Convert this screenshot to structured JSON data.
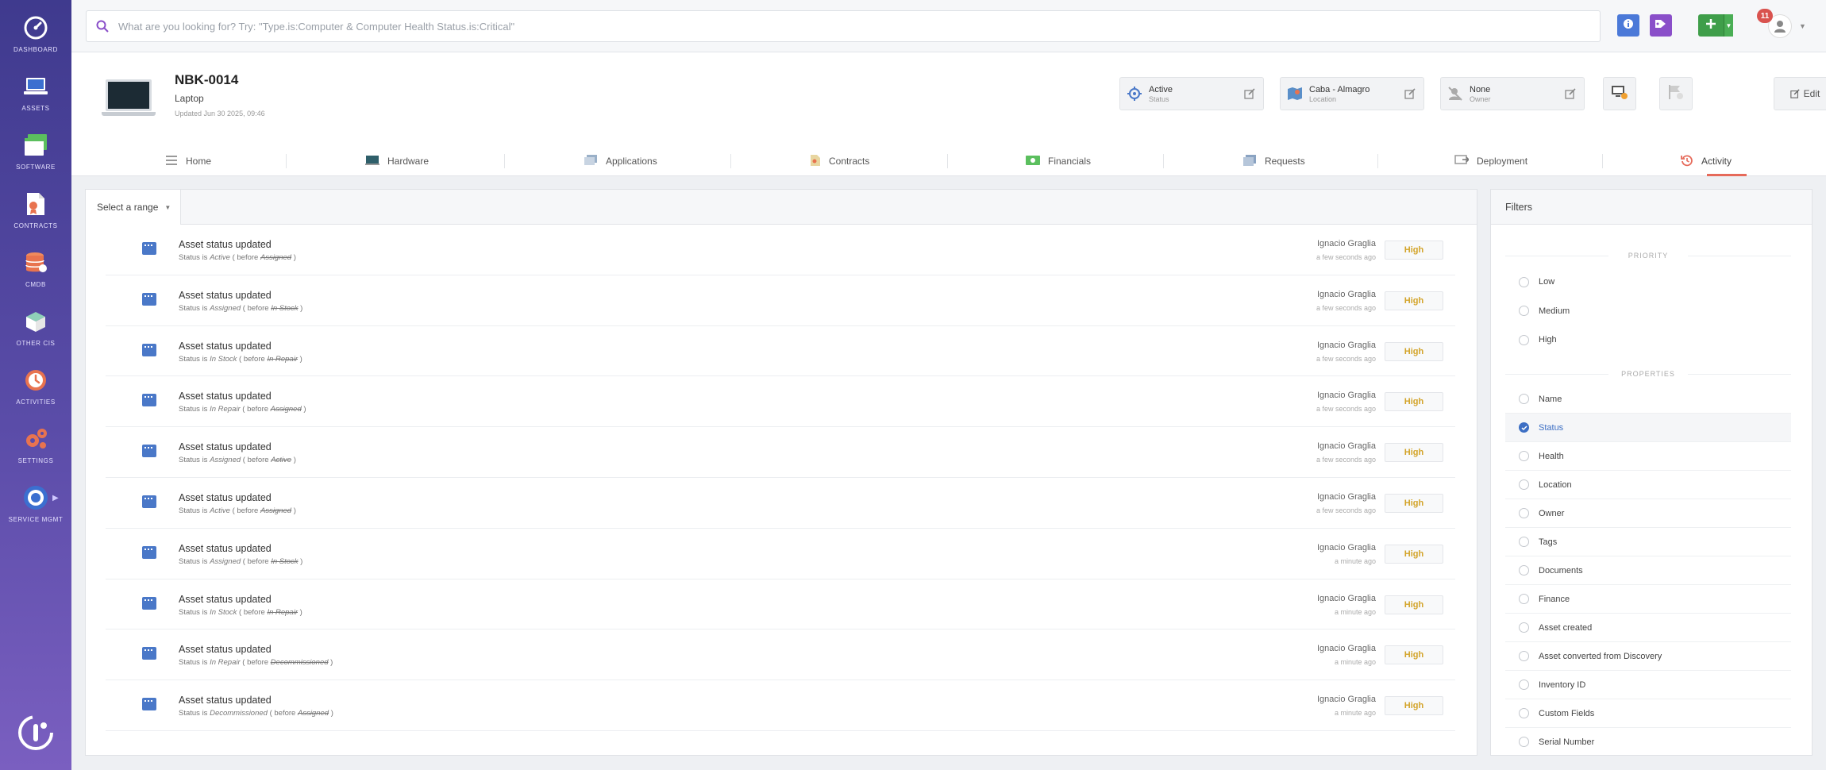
{
  "sidebar": {
    "items": [
      {
        "label": "DASHBOARD",
        "icon": "gauge-icon"
      },
      {
        "label": "ASSETS",
        "icon": "laptop-icon"
      },
      {
        "label": "SOFTWARE",
        "icon": "software-icon"
      },
      {
        "label": "CONTRACTS",
        "icon": "contract-icon"
      },
      {
        "label": "CMDB",
        "icon": "database-icon"
      },
      {
        "label": "OTHER CIS",
        "icon": "box-icon"
      },
      {
        "label": "ACTIVITIES",
        "icon": "clock-icon"
      },
      {
        "label": "SETTINGS",
        "icon": "gears-icon"
      },
      {
        "label": "SERVICE MGMT",
        "icon": "service-icon"
      }
    ]
  },
  "topbar": {
    "search_placeholder": "What are you looking for? Try: \"Type.is:Computer & Computer Health Status.is:Critical\"",
    "notification_count": "11",
    "colors": {
      "info": "#4b79d8",
      "tag": "#8a4fc9",
      "add": "#3f9e4a"
    }
  },
  "asset": {
    "name": "NBK-0014",
    "type": "Laptop",
    "updated": "Updated Jun 30 2025, 09:46",
    "status_value": "Active",
    "status_label": "Status",
    "location_value": "Caba - Almagro",
    "location_label": "Location",
    "owner_value": "None",
    "owner_label": "Owner",
    "edit_label": "Edit"
  },
  "tabs": [
    {
      "label": "Home",
      "icon": "list-icon"
    },
    {
      "label": "Hardware",
      "icon": "hardware-icon"
    },
    {
      "label": "Applications",
      "icon": "applications-icon"
    },
    {
      "label": "Contracts",
      "icon": "contracts-icon"
    },
    {
      "label": "Financials",
      "icon": "money-icon"
    },
    {
      "label": "Requests",
      "icon": "requests-icon"
    },
    {
      "label": "Deployment",
      "icon": "deployment-icon"
    },
    {
      "label": "Activity",
      "icon": "history-icon",
      "active": true
    }
  ],
  "main": {
    "range_label": "Select a range",
    "activities": [
      {
        "title": "Asset status updated",
        "prefix": "Status is ",
        "current": "Active",
        "mid": " ( before ",
        "previous": "Assigned",
        "suffix": " )",
        "user": "Ignacio Graglia",
        "time": "a few seconds ago",
        "priority": "High"
      },
      {
        "title": "Asset status updated",
        "prefix": "Status is ",
        "current": "Assigned",
        "mid": " ( before ",
        "previous": "In Stock",
        "suffix": " )",
        "user": "Ignacio Graglia",
        "time": "a few seconds ago",
        "priority": "High"
      },
      {
        "title": "Asset status updated",
        "prefix": "Status is ",
        "current": "In Stock",
        "mid": " ( before ",
        "previous": "In Repair",
        "suffix": " )",
        "user": "Ignacio Graglia",
        "time": "a few seconds ago",
        "priority": "High"
      },
      {
        "title": "Asset status updated",
        "prefix": "Status is ",
        "current": "In Repair",
        "mid": " ( before ",
        "previous": "Assigned",
        "suffix": " )",
        "user": "Ignacio Graglia",
        "time": "a few seconds ago",
        "priority": "High"
      },
      {
        "title": "Asset status updated",
        "prefix": "Status is ",
        "current": "Assigned",
        "mid": " ( before ",
        "previous": "Active",
        "suffix": " )",
        "user": "Ignacio Graglia",
        "time": "a few seconds ago",
        "priority": "High"
      },
      {
        "title": "Asset status updated",
        "prefix": "Status is ",
        "current": "Active",
        "mid": " ( before ",
        "previous": "Assigned",
        "suffix": " )",
        "user": "Ignacio Graglia",
        "time": "a few seconds ago",
        "priority": "High"
      },
      {
        "title": "Asset status updated",
        "prefix": "Status is ",
        "current": "Assigned",
        "mid": " ( before ",
        "previous": "In Stock",
        "suffix": " )",
        "user": "Ignacio Graglia",
        "time": "a minute ago",
        "priority": "High"
      },
      {
        "title": "Asset status updated",
        "prefix": "Status is ",
        "current": "In Stock",
        "mid": " ( before ",
        "previous": "In Repair",
        "suffix": " )",
        "user": "Ignacio Graglia",
        "time": "a minute ago",
        "priority": "High"
      },
      {
        "title": "Asset status updated",
        "prefix": "Status is ",
        "current": "In Repair",
        "mid": " ( before ",
        "previous": "Decommissioned",
        "suffix": " )",
        "user": "Ignacio Graglia",
        "time": "a minute ago",
        "priority": "High"
      },
      {
        "title": "Asset status updated",
        "prefix": "Status is ",
        "current": "Decommissioned",
        "mid": " ( before ",
        "previous": "Assigned",
        "suffix": " )",
        "user": "Ignacio Graglia",
        "time": "a minute ago",
        "priority": "High"
      }
    ]
  },
  "filters": {
    "title": "Filters",
    "priority_heading": "PRIORITY",
    "priority": [
      {
        "label": "Low",
        "checked": false
      },
      {
        "label": "Medium",
        "checked": false
      },
      {
        "label": "High",
        "checked": false
      }
    ],
    "properties_heading": "PROPERTIES",
    "properties": [
      {
        "label": "Name",
        "checked": false
      },
      {
        "label": "Status",
        "checked": true
      },
      {
        "label": "Health",
        "checked": false
      },
      {
        "label": "Location",
        "checked": false
      },
      {
        "label": "Owner",
        "checked": false
      },
      {
        "label": "Tags",
        "checked": false
      },
      {
        "label": "Documents",
        "checked": false
      },
      {
        "label": "Finance",
        "checked": false
      },
      {
        "label": "Asset created",
        "checked": false
      },
      {
        "label": "Asset converted from Discovery",
        "checked": false
      },
      {
        "label": "Inventory ID",
        "checked": false
      },
      {
        "label": "Custom Fields",
        "checked": false
      },
      {
        "label": "Serial Number",
        "checked": false
      }
    ]
  }
}
